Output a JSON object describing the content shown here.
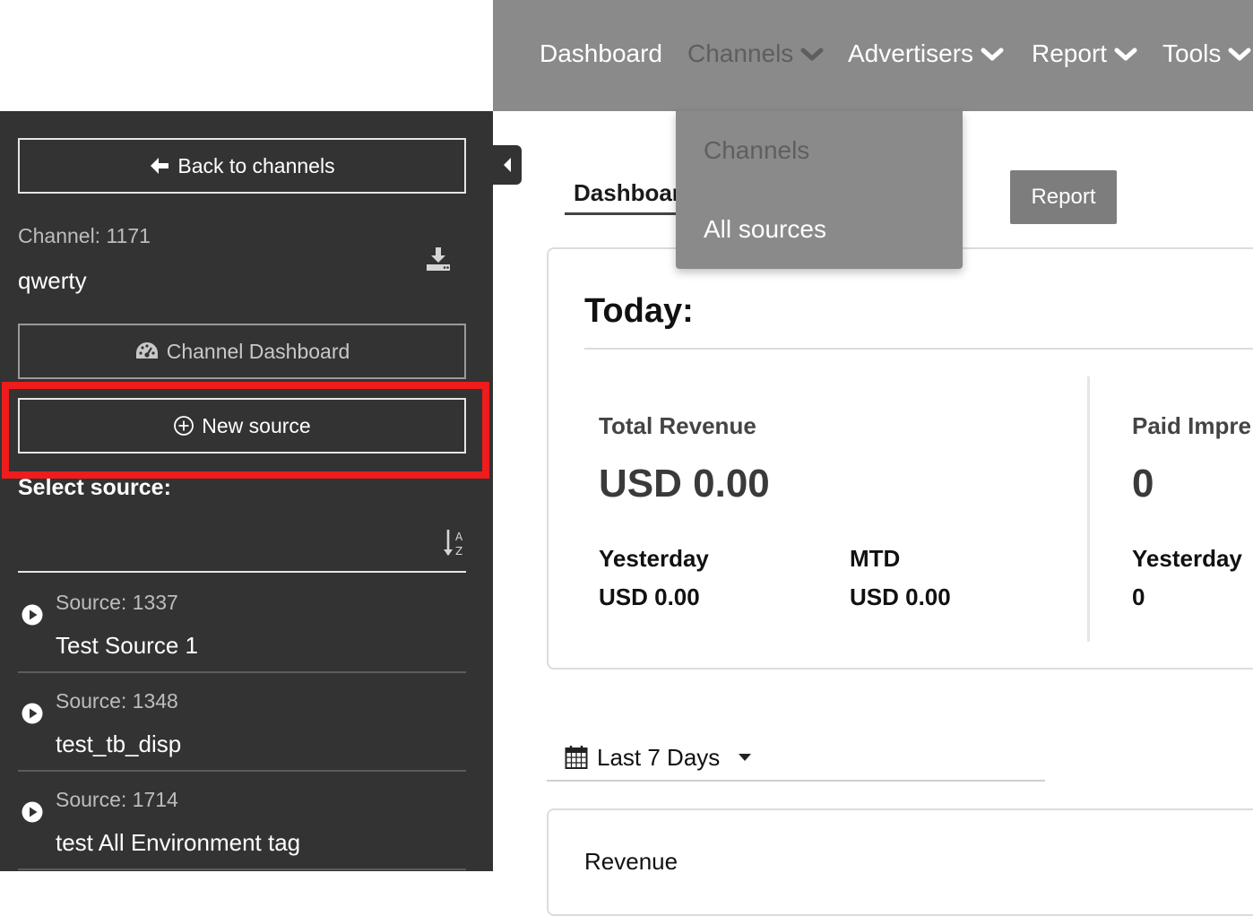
{
  "nav": {
    "items": [
      {
        "label": "Dashboard"
      },
      {
        "label": "Channels"
      },
      {
        "label": "Advertisers"
      },
      {
        "label": "Report"
      },
      {
        "label": "Tools"
      }
    ],
    "dropdown": [
      "Channels",
      "All sources"
    ]
  },
  "sidebar": {
    "back_label": "Back to channels",
    "channel_id": "Channel: 1171",
    "channel_name": "qwerty",
    "dashboard_label": "Channel Dashboard",
    "new_source_label": "New source",
    "select_label": "Select source:",
    "sources": [
      {
        "id": "Source: 1337",
        "name": "Test Source 1"
      },
      {
        "id": "Source: 1348",
        "name": "test_tb_disp"
      },
      {
        "id": "Source: 1714",
        "name": "test All Environment tag"
      }
    ]
  },
  "main": {
    "tab_dashboard": "Dashboard",
    "report_button": "Report",
    "today_title": "Today:",
    "total_revenue_label": "Total Revenue",
    "total_revenue_value": "USD 0.00",
    "yesterday_label": "Yesterday",
    "yesterday_value": "USD 0.00",
    "mtd_label": "MTD",
    "mtd_value": "USD 0.00",
    "paid_impr_label": "Paid Impre",
    "paid_impr_value": "0",
    "paid_yesterday_label": "Yesterday",
    "paid_yesterday_value": "0",
    "date_range": "Last 7 Days",
    "revenue_label": "Revenue"
  },
  "colors": {
    "sidebar_bg": "#333333",
    "topnav_bg": "#8a8a8a",
    "highlight": "#ee1c1c",
    "report_btn": "#7d7d7d"
  }
}
